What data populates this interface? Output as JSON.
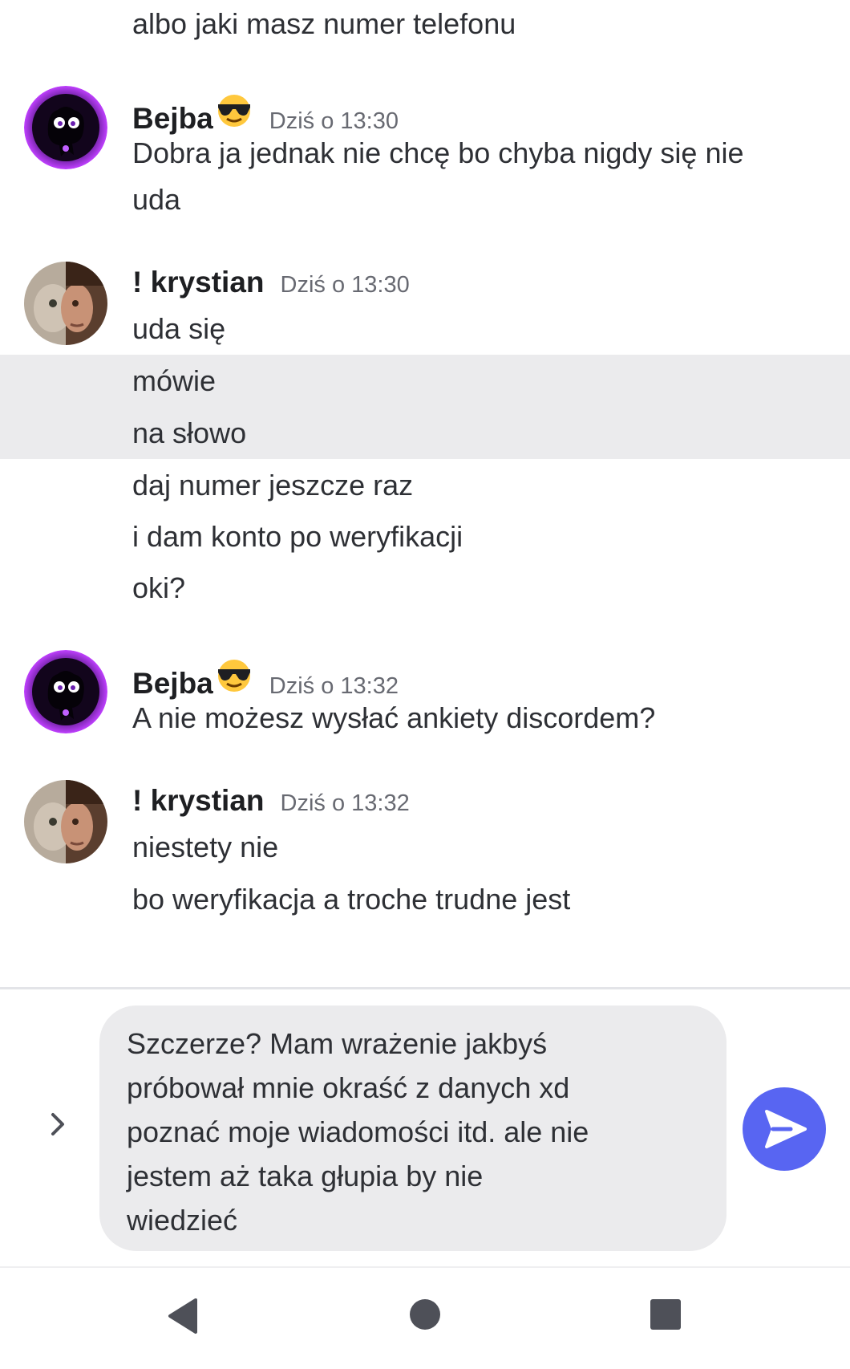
{
  "messages": {
    "top_line": "albo jaki masz numer telefonu",
    "group1": {
      "author": "Bejba",
      "author_emoji": "sunglasses-emoji",
      "time": "Dziś o 13:30",
      "lines": [
        "Dobra ja jednak nie chcę bo chyba nigdy się nie",
        "uda"
      ]
    },
    "group2": {
      "author": "! krystian",
      "time": "Dziś o 13:30",
      "lines": [
        "uda się",
        "mówie",
        "na słowo",
        "daj numer jeszcze raz",
        "i dam konto po weryfikacji",
        "oki?"
      ]
    },
    "group3": {
      "author": "Bejba",
      "author_emoji": "sunglasses-emoji",
      "time": "Dziś o 13:32",
      "lines": [
        "A nie możesz wysłać ankiety discordem?"
      ]
    },
    "group4": {
      "author": "! krystian",
      "time": "Dziś o 13:32",
      "lines": [
        "niestety nie",
        "bo weryfikacja a troche trudne jest"
      ]
    }
  },
  "composer": {
    "draft": "Szczerze? Mam wrażenie jakbyś\npróbował mnie okraść z danych xd\npoznać moje wiadomości itd. ale nie\njestem aż taka głupia by nie\nwiedzieć",
    "icons": [
      "chevron-right-icon",
      "emoji-icon",
      "send-icon"
    ],
    "accent": "#5865f2"
  },
  "navbar": {
    "icons": [
      "back-icon",
      "home-icon",
      "recents-icon"
    ]
  }
}
